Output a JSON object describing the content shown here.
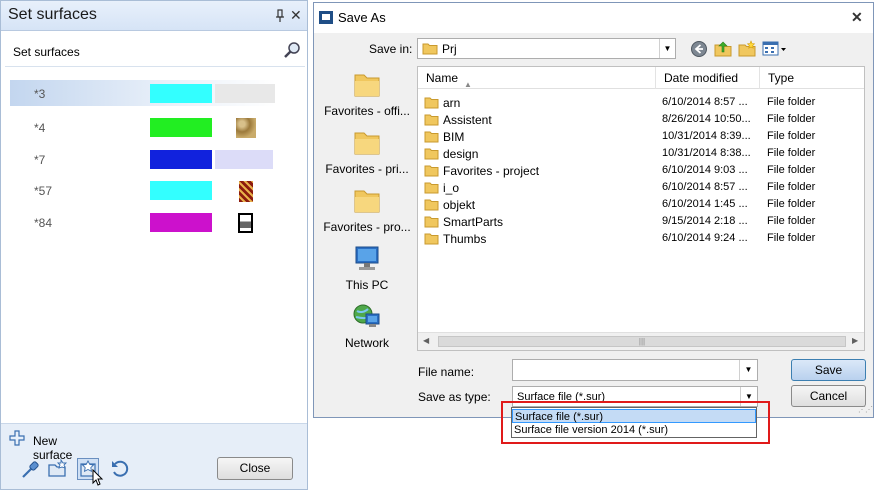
{
  "left_panel": {
    "title": "Set surfaces",
    "header": "Set surfaces",
    "surfaces": [
      {
        "label": "*3",
        "color": "#33ffff",
        "texture": "light-gray"
      },
      {
        "label": "*4",
        "color": "#22ee22",
        "texture": "gold-granite"
      },
      {
        "label": "*7",
        "color": "#1122dd",
        "texture": "lavender"
      },
      {
        "label": "*57",
        "color": "#33ffff",
        "texture": "red-pattern"
      },
      {
        "label": "*84",
        "color": "#cc11cc",
        "texture": "framed-image"
      }
    ],
    "new_surface_label": "New surface",
    "close_label": "Close",
    "tools": [
      "eyedropper-icon",
      "open-folder-icon",
      "save-star-icon",
      "undo-icon"
    ]
  },
  "dialog": {
    "title": "Save As",
    "save_in_label": "Save in:",
    "save_in_value": "Prj",
    "places": [
      "Favorites - offi...",
      "Favorites - pri...",
      "Favorites - pro...",
      "This PC",
      "Network"
    ],
    "columns": [
      "Name",
      "Date modified",
      "Type"
    ],
    "files": [
      {
        "name": "arn",
        "date": "6/10/2014 8:57 ...",
        "type": "File folder"
      },
      {
        "name": "Assistent",
        "date": "8/26/2014 10:50...",
        "type": "File folder"
      },
      {
        "name": "BIM",
        "date": "10/31/2014 8:39...",
        "type": "File folder"
      },
      {
        "name": "design",
        "date": "10/31/2014 8:38...",
        "type": "File folder"
      },
      {
        "name": "Favorites - project",
        "date": "6/10/2014 9:03 ...",
        "type": "File folder"
      },
      {
        "name": "i_o",
        "date": "6/10/2014 8:57 ...",
        "type": "File folder"
      },
      {
        "name": "objekt",
        "date": "6/10/2014 1:45 ...",
        "type": "File folder"
      },
      {
        "name": "SmartParts",
        "date": "9/15/2014 2:18 ...",
        "type": "File folder"
      },
      {
        "name": "Thumbs",
        "date": "6/10/2014 9:24 ...",
        "type": "File folder"
      }
    ],
    "file_name_label": "File name:",
    "file_name_value": "",
    "save_as_type_label": "Save as type:",
    "save_as_type_value": "Surface file (*.sur)",
    "save_label": "Save",
    "cancel_label": "Cancel",
    "type_options": [
      "Surface file (*.sur)",
      "Surface file version 2014 (*.sur)"
    ]
  },
  "colors": {
    "highlight": "#e01a1a",
    "selection": "#c4dbf5",
    "folder": "#f0c75e"
  }
}
